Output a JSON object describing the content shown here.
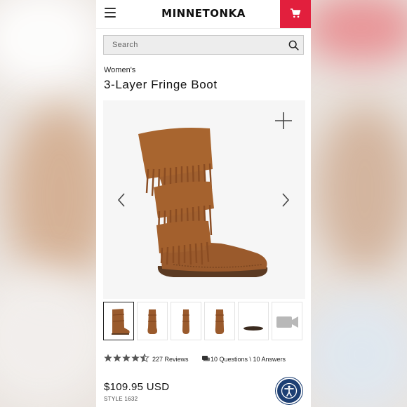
{
  "header": {
    "brand": "MINNETONKA",
    "menu_icon": "hamburger-menu-icon",
    "cart_icon": "shopping-cart-icon",
    "cart_color": "#e21f3d"
  },
  "search": {
    "placeholder": "Search",
    "icon": "search-icon"
  },
  "product": {
    "category": "Women's",
    "title": "3-Layer Fringe Boot",
    "price": "$109.95 USD",
    "style": "STYLE 1632",
    "color": "#9a5a2c"
  },
  "gallery": {
    "zoom_icon": "plus-icon",
    "prev_icon": "chevron-left-icon",
    "next_icon": "chevron-right-icon",
    "thumbnails": [
      "boot-side-view",
      "boot-front-view",
      "boot-back-view",
      "boot-angle-view",
      "boot-sole-view",
      "video-icon"
    ]
  },
  "rating": {
    "stars": 4.5,
    "max_stars": 5,
    "reviews": "227 Reviews",
    "qa": "10 Questions \\ 10 Answers"
  },
  "accessibility": {
    "icon": "accessibility-icon",
    "color": "#1d3f73"
  }
}
